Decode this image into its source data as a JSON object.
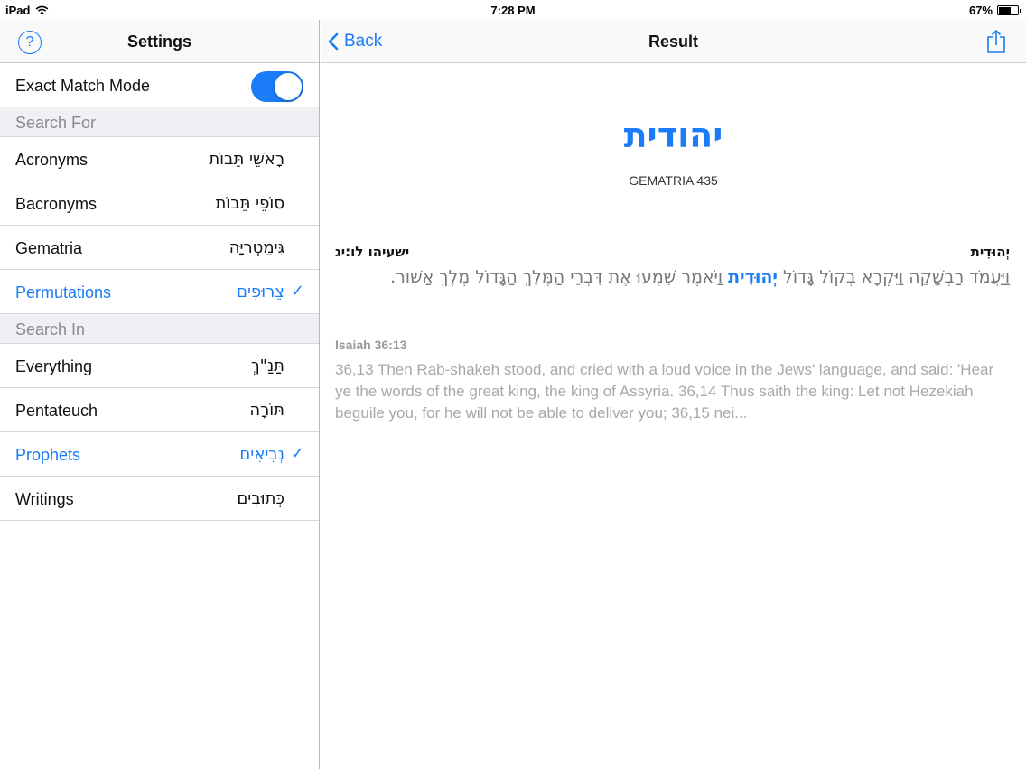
{
  "status_bar": {
    "device": "iPad",
    "time": "7:28 PM",
    "battery": "67%",
    "battery_level": 0.67
  },
  "settings": {
    "title": "Settings",
    "help_icon": "question-circle-icon",
    "exact_match": {
      "label": "Exact Match Mode",
      "enabled": true
    },
    "search_for_header": "Search For",
    "search_for": [
      {
        "label": "Acronyms",
        "hebrew": "רָאשֵׁי תֵּבוֹת",
        "selected": false
      },
      {
        "label": "Bacronyms",
        "hebrew": "סוֹפֵי תֵּבוֹת",
        "selected": false
      },
      {
        "label": "Gematria",
        "hebrew": "גִּימַטְרִיָּה",
        "selected": false
      },
      {
        "label": "Permutations",
        "hebrew": "צֵרוּפִים",
        "selected": true
      }
    ],
    "search_in_header": "Search In",
    "search_in": [
      {
        "label": "Everything",
        "hebrew": "תַּנַ\"ךְ",
        "selected": false
      },
      {
        "label": "Pentateuch",
        "hebrew": "תּוֹרָה",
        "selected": false
      },
      {
        "label": "Prophets",
        "hebrew": "נְבִיאִים",
        "selected": true
      },
      {
        "label": "Writings",
        "hebrew": "כְּתוּבִים",
        "selected": false
      }
    ]
  },
  "result": {
    "back_label": "Back",
    "title": "Result",
    "share_icon": "share-icon",
    "word": "יהודית",
    "gematria": "GEMATRIA 435",
    "verse_word": "יְהוּדִית",
    "verse_ref_hebrew": "ישעיהו לו:יג",
    "verse_before": "וַיַּעֲמֹד רַבְשָׁקֵה וַיִּקְרָא בְקוֹל גָּדוֹל ",
    "verse_highlight": "יְהוּדִית",
    "verse_after": " וַיֹּאמֶר שִׁמְעוּ אֶת דִּבְרֵי הַמֶּלֶךְ הַגָּדוֹל מֶלֶךְ אַשּׁוּר.",
    "english_ref": "Isaiah 36:13",
    "english_text": "36,13 Then Rab-shakeh stood, and cried with a loud voice in the Jews' language, and said: 'Hear ye the words of the great king, the king of Assyria. 36,14 Thus saith the king: Let not Hezekiah beguile you, for he will not be able to deliver you; 36,15 nei..."
  },
  "colors": {
    "accent": "#1a7cf6",
    "section_bg": "#efeff4"
  }
}
